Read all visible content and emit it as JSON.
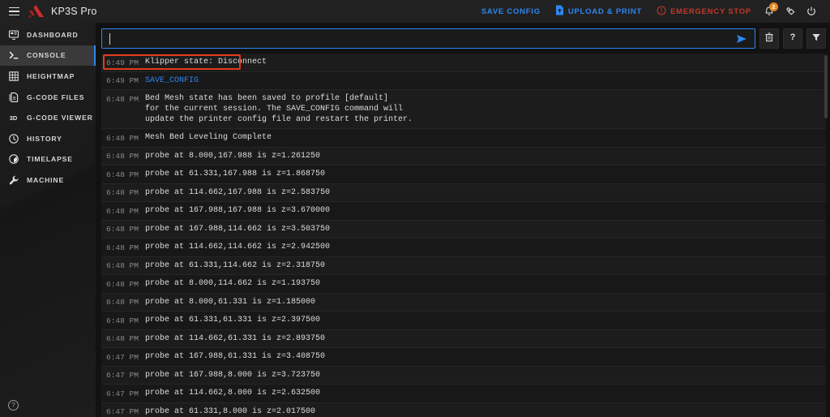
{
  "header": {
    "menu_icon": "hamburger-icon",
    "logo_icon": "kp3s-logo-icon",
    "title": "KP3S Pro",
    "actions": {
      "save_config": "SAVE CONFIG",
      "upload_print": "UPLOAD & PRINT",
      "emergency_stop": "EMERGENCY STOP",
      "upload_icon": "upload-file-icon",
      "emergency_icon": "alert-circle-icon",
      "notifications_icon": "bell-icon",
      "notifications_badge": "2",
      "settings_icon": "gear-icon",
      "power_icon": "power-icon"
    }
  },
  "sidebar": {
    "items": [
      {
        "label": "DASHBOARD",
        "icon": "dashboard-icon",
        "active": false
      },
      {
        "label": "CONSOLE",
        "icon": "terminal-icon",
        "active": true
      },
      {
        "label": "HEIGHTMAP",
        "icon": "grid-icon",
        "active": false
      },
      {
        "label": "G-CODE FILES",
        "icon": "file-code-icon",
        "active": false
      },
      {
        "label": "G-CODE VIEWER",
        "icon": "cube-3d-icon",
        "active": false
      },
      {
        "label": "HISTORY",
        "icon": "clock-history-icon",
        "active": false
      },
      {
        "label": "TIMELAPSE",
        "icon": "timelapse-icon",
        "active": false
      },
      {
        "label": "MACHINE",
        "icon": "wrench-icon",
        "active": false
      }
    ],
    "help_label": "?",
    "help_icon": "help-circle-icon"
  },
  "console": {
    "input": {
      "value": "",
      "placeholder": ""
    },
    "send_icon": "send-arrow-icon",
    "buttons": [
      {
        "name": "clear-console-button",
        "icon": "trash-icon",
        "label": ""
      },
      {
        "name": "console-help-button",
        "icon": "question-icon",
        "label": "?"
      },
      {
        "name": "console-filter-button",
        "icon": "filter-icon",
        "label": ""
      }
    ],
    "entries": [
      {
        "time": "6:49 PM",
        "message": "Klipper state: Disconnect",
        "type": "response",
        "highlighted": true
      },
      {
        "time": "6:49 PM",
        "message": "SAVE_CONFIG",
        "type": "command",
        "highlighted": false
      },
      {
        "time": "6:48 PM",
        "message": "Bed Mesh state has been saved to profile [default]\nfor the current session. The SAVE_CONFIG command will\nupdate the printer config file and restart the printer.",
        "type": "response",
        "highlighted": false
      },
      {
        "time": "6:48 PM",
        "message": "Mesh Bed Leveling Complete",
        "type": "response",
        "highlighted": false
      },
      {
        "time": "6:48 PM",
        "message": "probe at 8.000,167.988 is z=1.261250",
        "type": "response",
        "highlighted": false
      },
      {
        "time": "6:48 PM",
        "message": "probe at 61.331,167.988 is z=1.868750",
        "type": "response",
        "highlighted": false
      },
      {
        "time": "6:48 PM",
        "message": "probe at 114.662,167.988 is z=2.583750",
        "type": "response",
        "highlighted": false
      },
      {
        "time": "6:48 PM",
        "message": "probe at 167.988,167.988 is z=3.670000",
        "type": "response",
        "highlighted": false
      },
      {
        "time": "6:48 PM",
        "message": "probe at 167.988,114.662 is z=3.503750",
        "type": "response",
        "highlighted": false
      },
      {
        "time": "6:48 PM",
        "message": "probe at 114.662,114.662 is z=2.942500",
        "type": "response",
        "highlighted": false
      },
      {
        "time": "6:48 PM",
        "message": "probe at 61.331,114.662 is z=2.318750",
        "type": "response",
        "highlighted": false
      },
      {
        "time": "6:48 PM",
        "message": "probe at 8.000,114.662 is z=1.193750",
        "type": "response",
        "highlighted": false
      },
      {
        "time": "6:48 PM",
        "message": "probe at 8.000,61.331 is z=1.185000",
        "type": "response",
        "highlighted": false
      },
      {
        "time": "6:48 PM",
        "message": "probe at 61.331,61.331 is z=2.397500",
        "type": "response",
        "highlighted": false
      },
      {
        "time": "6:48 PM",
        "message": "probe at 114.662,61.331 is z=2.893750",
        "type": "response",
        "highlighted": false
      },
      {
        "time": "6:47 PM",
        "message": "probe at 167.988,61.331 is z=3.408750",
        "type": "response",
        "highlighted": false
      },
      {
        "time": "6:47 PM",
        "message": "probe at 167.988,8.000 is z=3.723750",
        "type": "response",
        "highlighted": false
      },
      {
        "time": "6:47 PM",
        "message": "probe at 114.662,8.000 is z=2.632500",
        "type": "response",
        "highlighted": false
      },
      {
        "time": "6:47 PM",
        "message": "probe at 61.331,8.000 is z=2.017500",
        "type": "response",
        "highlighted": false
      }
    ]
  },
  "colors": {
    "accent_blue": "#2e86f0",
    "danger_red": "#c0392b",
    "badge_orange": "#e8871e",
    "highlight_red": "#e03a1e",
    "logo_red": "#d32b2b",
    "header_bg": "#212121",
    "sidebar_bg": "#1b1b1b",
    "page_bg": "#121212",
    "row_bg": "#1c1c1c"
  }
}
